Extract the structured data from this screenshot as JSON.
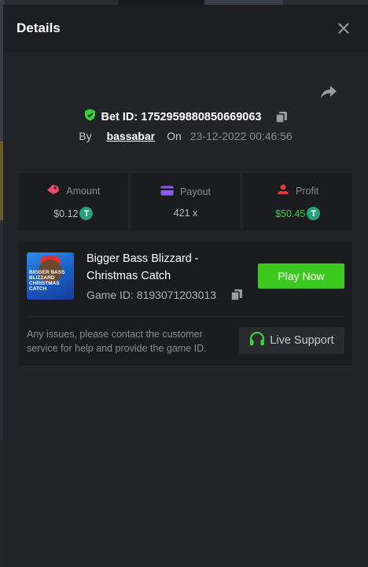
{
  "modal": {
    "title": "Details"
  },
  "bet": {
    "label": "Bet ID:",
    "id": "1752959880850669063"
  },
  "meta": {
    "by_label": "By",
    "username": "bassabar",
    "on_label": "On",
    "date": "23-12-2022 00:46:56"
  },
  "stats": {
    "amount": {
      "label": "Amount",
      "value": "$0.12"
    },
    "payout": {
      "label": "Payout",
      "value": "421 x"
    },
    "profit": {
      "label": "Profit",
      "value": "$50.45"
    }
  },
  "game": {
    "title": "Bigger Bass Blizzard - Christmas Catch",
    "id_label": "Game ID:",
    "id": "8193071203013",
    "thumbnail_text": "BIGGER BASS BLIZZARD CHRISTMAS CATCH",
    "play_label": "Play Now"
  },
  "support": {
    "message": "Any issues, please contact the customer service for help and provide the game ID.",
    "button_label": "Live Support"
  },
  "colors": {
    "accent_green": "#3bc81f",
    "profit_green": "#36d43c",
    "coin_teal": "#27a17c",
    "amount_red": "#ee4b6a",
    "payout_purple": "#8f5cf0"
  }
}
